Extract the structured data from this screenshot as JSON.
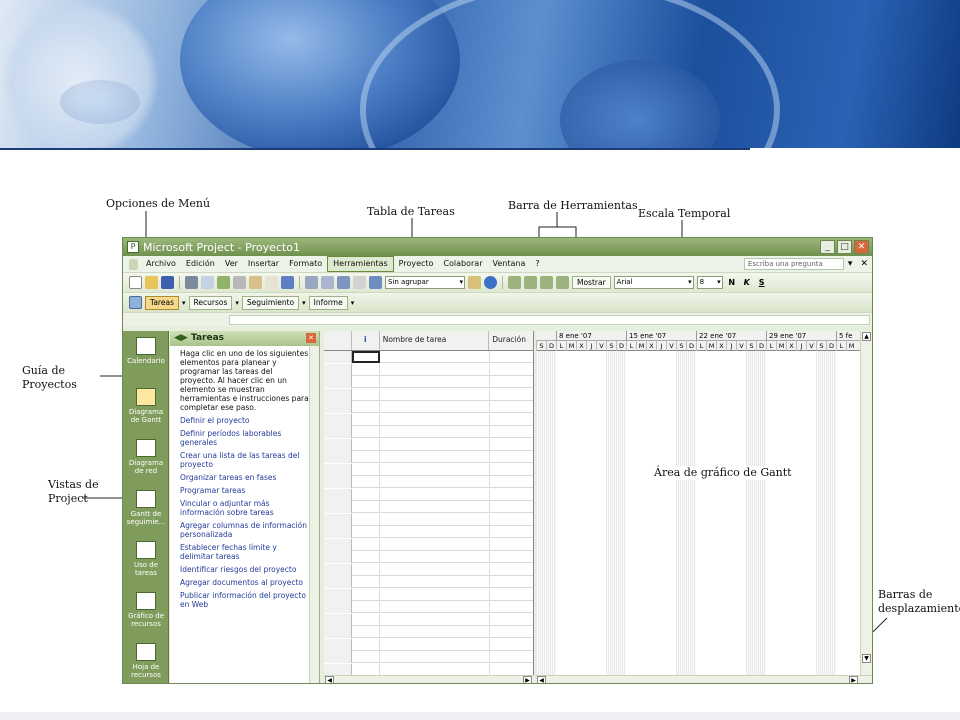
{
  "annotations": {
    "menu_options": "Opciones de Menú",
    "task_table": "Tabla de Tareas",
    "toolbar": "Barra de Herramientas",
    "timescale": "Escala Temporal",
    "project_guide": "Guía de Proyectos",
    "project_views": "Vistas de Project",
    "gantt_area": "Área de gráfico de Gantt",
    "scrollbars": "Barras de desplazamiento"
  },
  "window": {
    "title": "Microsoft Project - Proyecto1"
  },
  "menu": {
    "items": [
      "Archivo",
      "Edición",
      "Ver",
      "Insertar",
      "Formato",
      "Herramientas",
      "Proyecto",
      "Colaborar",
      "Ventana",
      "?"
    ],
    "active": "Herramientas",
    "ask_placeholder": "Escriba una pregunta"
  },
  "toolbar": {
    "group_select": "Sin agrupar",
    "show_label": "Mostrar",
    "font_select": "Arial",
    "size_select": "8",
    "bold": "N",
    "italic": "K",
    "underline": "S"
  },
  "guide_bar": {
    "items": [
      "Tareas",
      "Recursos",
      "Seguimiento",
      "Informe"
    ],
    "active": "Tareas"
  },
  "views": [
    {
      "label": "Calendario",
      "icon": "calendar-view-icon"
    },
    {
      "label": "Diagrama de Gantt",
      "icon": "gantt-view-icon",
      "active": true
    },
    {
      "label": "Diagrama de red",
      "icon": "network-view-icon"
    },
    {
      "label": "Gantt de seguimie...",
      "icon": "tracking-gantt-icon"
    },
    {
      "label": "Uso de tareas",
      "icon": "task-usage-icon"
    },
    {
      "label": "Gráfico de recursos",
      "icon": "resource-graph-icon"
    },
    {
      "label": "Hoja de recursos",
      "icon": "resource-sheet-icon"
    }
  ],
  "task_pane": {
    "title": "Tareas",
    "intro": "Haga clic en uno de los siguientes elementos para planear y programar las tareas del proyecto. Al hacer clic en un elemento se muestran herramientas e instrucciones para completar ese paso.",
    "links": [
      "Definir el proyecto",
      "Definir períodos laborables generales",
      "Crear una lista de las tareas del proyecto",
      "Organizar tareas en fases",
      "Programar tareas",
      "Vincular o adjuntar más información sobre tareas",
      "Agregar columnas de información personalizada",
      "Establecer fechas límite y delimitar tareas",
      "Identificar riesgos del proyecto",
      "Agregar documentos al proyecto",
      "Publicar información del proyecto en Web"
    ]
  },
  "task_table": {
    "info_header": "i",
    "name_header": "Nombre de tarea",
    "duration_header": "Duración"
  },
  "timescale": {
    "weeks": [
      "8 ene '07",
      "15 ene '07",
      "22 ene '07",
      "29 ene '07",
      "5 fe"
    ],
    "days": [
      "S",
      "D",
      "L",
      "M",
      "X",
      "J",
      "V",
      "S",
      "D",
      "L",
      "M",
      "X",
      "J",
      "V",
      "S",
      "D",
      "L",
      "M",
      "X",
      "J",
      "V",
      "S",
      "D",
      "L",
      "M",
      "X",
      "J",
      "V",
      "S",
      "D",
      "L",
      "M"
    ]
  },
  "colors": {
    "window_frame": "#6f914d",
    "view_bar": "#7f9c5c",
    "link": "#243b9a",
    "active_menu": "#dfe9cf"
  }
}
